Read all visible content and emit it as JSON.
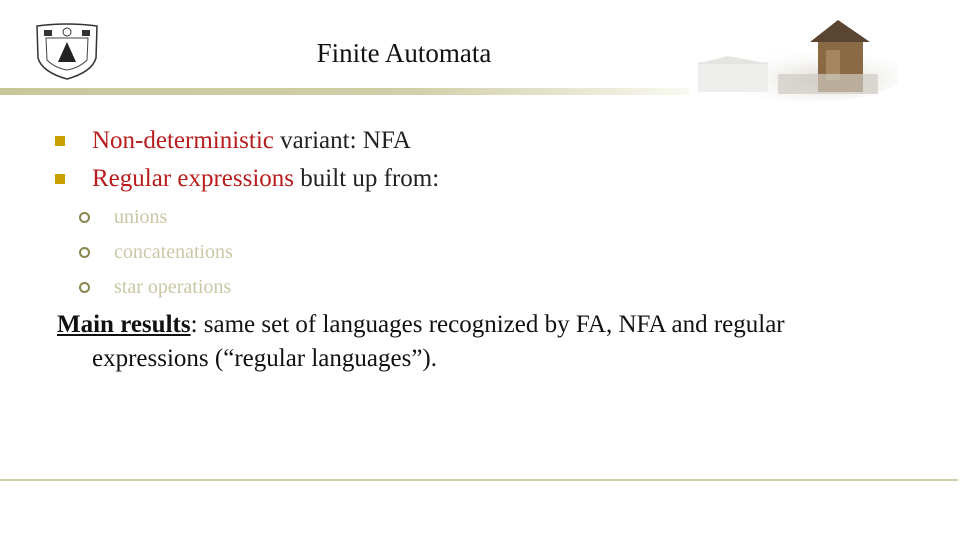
{
  "header": {
    "logo_icon": "university-crest-icon",
    "title": "Finite Automata",
    "decoration_image": "ancient-tower-building-image"
  },
  "bullets": [
    {
      "highlight": "Non-deterministic",
      "rest": " variant: NFA"
    },
    {
      "highlight": "Regular expressions",
      "rest": " built up from:"
    }
  ],
  "sub_bullets": [
    "unions",
    "concatenations",
    "star operations"
  ],
  "main_result": {
    "label": "Main results",
    "text_line1": ": same set of languages recognized by FA, NFA and regular",
    "text_line2": "expressions (“regular languages”)."
  },
  "colors": {
    "highlight": "#b81c1c",
    "bullet_square": "#c8a000",
    "sub_text": "#c9c7a6",
    "rule": "#cfcca6"
  }
}
